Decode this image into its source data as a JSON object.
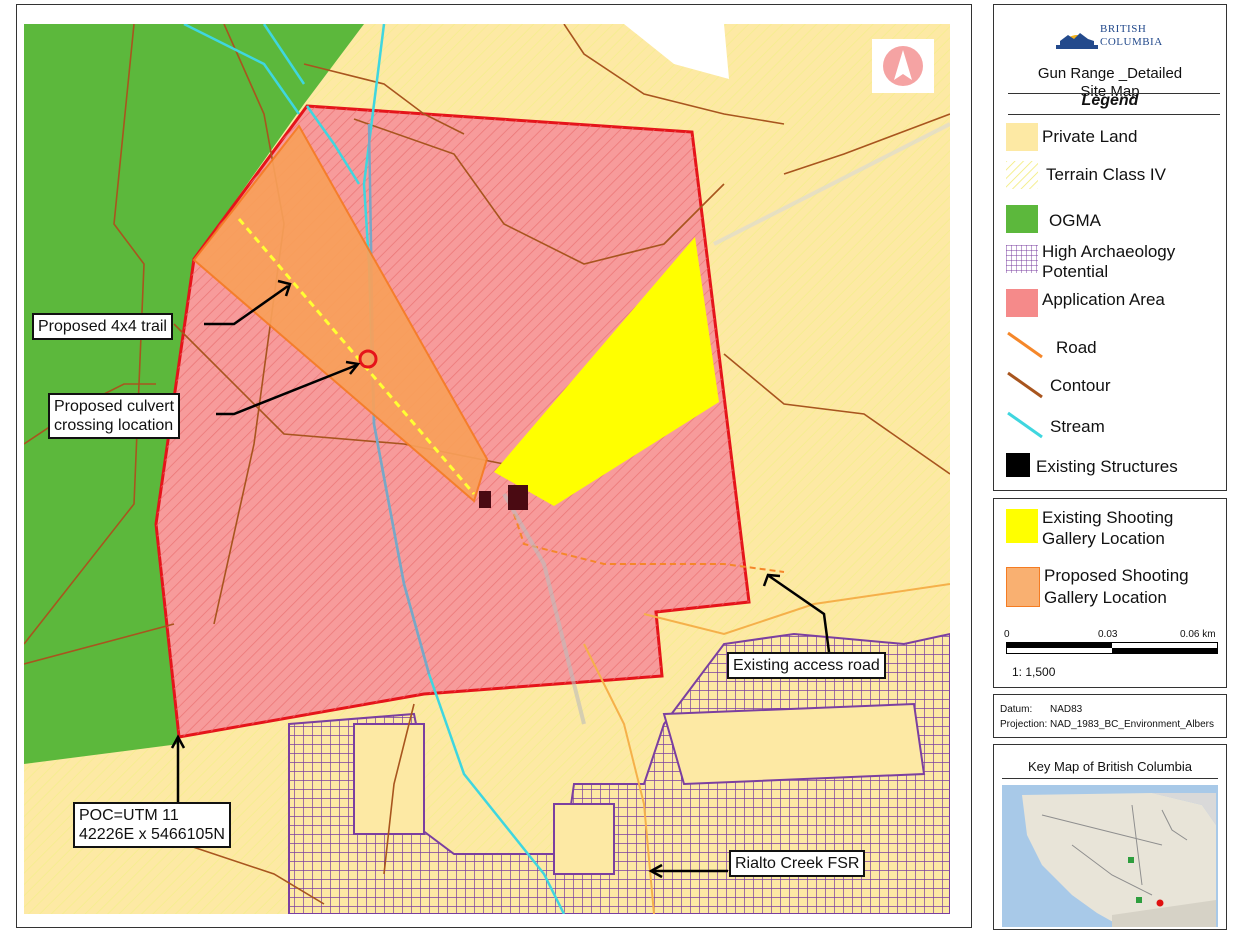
{
  "map": {
    "labels": {
      "trail": "Proposed 4x4 trail",
      "culvert_line1": "Proposed culvert",
      "culvert_line2": "crossing location",
      "access_road": "Existing access road",
      "poc_line1": "POC=UTM 11",
      "poc_line2": "42226E x 5466105N",
      "rialto": "Rialto Creek FSR"
    },
    "north_arrow_icon": "north-arrow-icon"
  },
  "legend": {
    "logo_line1": "BRITISH",
    "logo_line2": "COLUMBIA",
    "title_line1": "Gun Range _Detailed",
    "title_line2": "Site Map",
    "heading": "Legend",
    "items": [
      {
        "label": "Private Land",
        "color": "#fde9a4"
      },
      {
        "label": "Terrain Class IV",
        "color": "#ffff66"
      },
      {
        "label": "OGMA",
        "color": "#5cb83c"
      },
      {
        "label": "High Archaeology",
        "label2": "Potential",
        "color": "#7b3fa0"
      },
      {
        "label": "Application Area",
        "color": "#f58a8a"
      },
      {
        "label": "Road",
        "color": "#f5872a"
      },
      {
        "label": "Contour",
        "color": "#a8551e"
      },
      {
        "label": "Stream",
        "color": "#3fd6df"
      },
      {
        "label": "Existing Structures",
        "color": "#000000"
      }
    ],
    "gallery": [
      {
        "label": "Existing Shooting",
        "label2": "Gallery Location",
        "color": "#ffff00"
      },
      {
        "label": "Proposed Shooting",
        "label2": "Gallery Location",
        "color": "#f9b071"
      }
    ],
    "scale": {
      "t0": "0",
      "t1": "0.03",
      "t2": "0.06 km",
      "ratio": "1: 1,500"
    },
    "datum": {
      "datum_label": "Datum:",
      "datum_value": "NAD83",
      "projection": "Projection: NAD_1983_BC_Environment_Albers"
    },
    "keymap_title": "Key Map of British Columbia"
  }
}
